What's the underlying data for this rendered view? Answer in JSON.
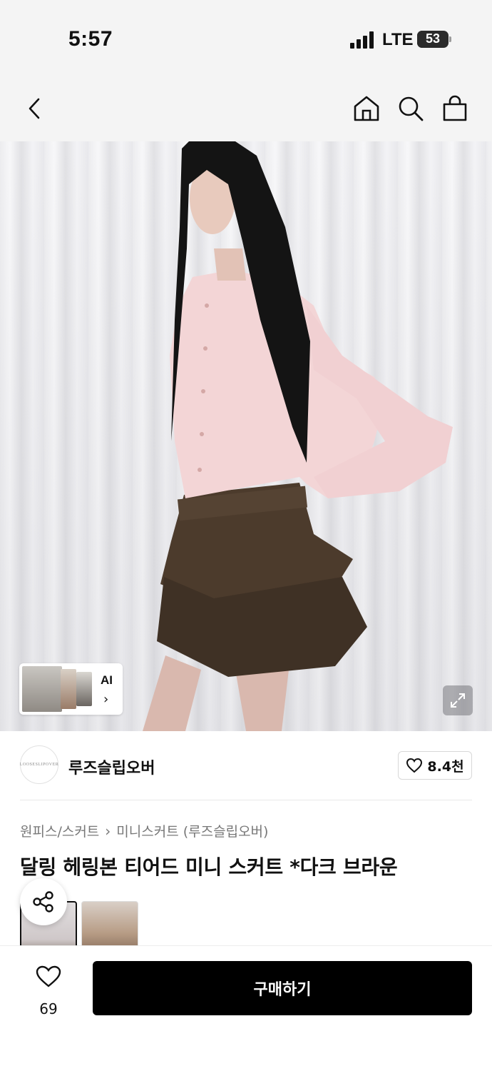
{
  "status_bar": {
    "time": "5:57",
    "network": "LTE",
    "battery": "53",
    "battery_fraction": 0.53
  },
  "nav": {
    "back_icon": "chevron-left-icon",
    "home_icon": "home-icon",
    "search_icon": "search-icon",
    "cart_icon": "shopping-bag-icon"
  },
  "gallery": {
    "ai_label": "AI",
    "ai_chevron": "›",
    "expand_icon": "expand-icon"
  },
  "brand": {
    "logo_text": "LOOSESLIPOVER",
    "name": "루즈슬립오버",
    "likes": "8.4천"
  },
  "breadcrumb": {
    "items": [
      "원피스/스커트",
      "미니스커트 (루즈슬립오버)"
    ],
    "separator": "›"
  },
  "product": {
    "title": "달링 헤링본 티어드 미니 스커트 *다크 브라운"
  },
  "bottom_bar": {
    "wish_count": "69",
    "buy_label": "구매하기"
  },
  "colors": {
    "accent": "#000000",
    "background": "#ffffff",
    "nav_background": "#f4f4f4"
  }
}
